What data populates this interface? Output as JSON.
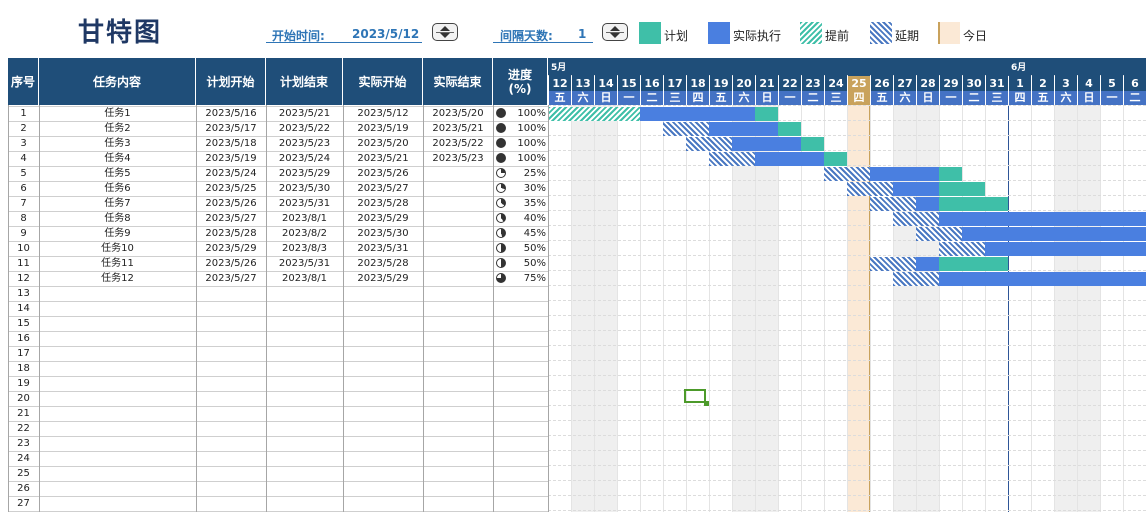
{
  "title": "甘特图",
  "controls": {
    "start_label": "开始时间:",
    "start_value": "2023/5/12",
    "interval_label": "间隔天数:",
    "interval_value": "1"
  },
  "legend": [
    {
      "label": "计划",
      "kind": "plan",
      "color": "#3FBFA8"
    },
    {
      "label": "实际执行",
      "kind": "actual",
      "color": "#4A7FE0"
    },
    {
      "label": "提前",
      "kind": "early",
      "color": "#3FBFA8"
    },
    {
      "label": "延期",
      "kind": "delay",
      "color": "#4A78C2"
    },
    {
      "label": "今日",
      "kind": "today",
      "color": "#FBE9D6"
    }
  ],
  "columns": [
    "序号",
    "任务内容",
    "计划开始",
    "计划结束",
    "实际开始",
    "实际结束",
    "进度\n(%)"
  ],
  "tasks": [
    {
      "no": "1",
      "name": "任务1",
      "plan_start": "2023/5/16",
      "plan_end": "2023/5/21",
      "act_start": "2023/5/12",
      "act_end": "2023/5/20",
      "progress": "100%",
      "pct": 1.0
    },
    {
      "no": "2",
      "name": "任务2",
      "plan_start": "2023/5/17",
      "plan_end": "2023/5/22",
      "act_start": "2023/5/19",
      "act_end": "2023/5/21",
      "progress": "100%",
      "pct": 1.0
    },
    {
      "no": "3",
      "name": "任务3",
      "plan_start": "2023/5/18",
      "plan_end": "2023/5/23",
      "act_start": "2023/5/20",
      "act_end": "2023/5/22",
      "progress": "100%",
      "pct": 1.0
    },
    {
      "no": "4",
      "name": "任务4",
      "plan_start": "2023/5/19",
      "plan_end": "2023/5/24",
      "act_start": "2023/5/21",
      "act_end": "2023/5/23",
      "progress": "100%",
      "pct": 1.0
    },
    {
      "no": "5",
      "name": "任务5",
      "plan_start": "2023/5/24",
      "plan_end": "2023/5/29",
      "act_start": "2023/5/26",
      "act_end": "",
      "progress": "25%",
      "pct": 0.25
    },
    {
      "no": "6",
      "name": "任务6",
      "plan_start": "2023/5/25",
      "plan_end": "2023/5/30",
      "act_start": "2023/5/27",
      "act_end": "",
      "progress": "30%",
      "pct": 0.3
    },
    {
      "no": "7",
      "name": "任务7",
      "plan_start": "2023/5/26",
      "plan_end": "2023/5/31",
      "act_start": "2023/5/28",
      "act_end": "",
      "progress": "35%",
      "pct": 0.35
    },
    {
      "no": "8",
      "name": "任务8",
      "plan_start": "2023/5/27",
      "plan_end": "2023/8/1",
      "act_start": "2023/5/29",
      "act_end": "",
      "progress": "40%",
      "pct": 0.4
    },
    {
      "no": "9",
      "name": "任务9",
      "plan_start": "2023/5/28",
      "plan_end": "2023/8/2",
      "act_start": "2023/5/30",
      "act_end": "",
      "progress": "45%",
      "pct": 0.45
    },
    {
      "no": "10",
      "name": "任务10",
      "plan_start": "2023/5/29",
      "plan_end": "2023/8/3",
      "act_start": "2023/5/31",
      "act_end": "",
      "progress": "50%",
      "pct": 0.5
    },
    {
      "no": "11",
      "name": "任务11",
      "plan_start": "2023/5/26",
      "plan_end": "2023/5/31",
      "act_start": "2023/5/28",
      "act_end": "",
      "progress": "50%",
      "pct": 0.5
    },
    {
      "no": "12",
      "name": "任务12",
      "plan_start": "2023/5/27",
      "plan_end": "2023/8/1",
      "act_start": "2023/5/29",
      "act_end": "",
      "progress": "75%",
      "pct": 0.75
    }
  ],
  "empty_rows": [
    "13",
    "14",
    "15",
    "16",
    "17",
    "18",
    "19",
    "20",
    "21",
    "22",
    "23",
    "24",
    "25",
    "26",
    "27"
  ],
  "calendar": {
    "months": [
      {
        "label": "5月",
        "start_index": 0
      },
      {
        "label": "6月",
        "start_index": 20
      }
    ],
    "days": [
      {
        "d": "12",
        "w": "五"
      },
      {
        "d": "13",
        "w": "六"
      },
      {
        "d": "14",
        "w": "日"
      },
      {
        "d": "15",
        "w": "一"
      },
      {
        "d": "16",
        "w": "二"
      },
      {
        "d": "17",
        "w": "三"
      },
      {
        "d": "18",
        "w": "四"
      },
      {
        "d": "19",
        "w": "五"
      },
      {
        "d": "20",
        "w": "六"
      },
      {
        "d": "21",
        "w": "日"
      },
      {
        "d": "22",
        "w": "一"
      },
      {
        "d": "23",
        "w": "二"
      },
      {
        "d": "24",
        "w": "三"
      },
      {
        "d": "25",
        "w": "四"
      },
      {
        "d": "26",
        "w": "五"
      },
      {
        "d": "27",
        "w": "六"
      },
      {
        "d": "28",
        "w": "日"
      },
      {
        "d": "29",
        "w": "一"
      },
      {
        "d": "30",
        "w": "二"
      },
      {
        "d": "31",
        "w": "三"
      },
      {
        "d": "1",
        "w": "四"
      },
      {
        "d": "2",
        "w": "五"
      },
      {
        "d": "3",
        "w": "六"
      },
      {
        "d": "4",
        "w": "日"
      },
      {
        "d": "5",
        "w": "一"
      },
      {
        "d": "6",
        "w": "二"
      }
    ],
    "today_index": 13,
    "calendar_start": "2023/5/12"
  },
  "colors": {
    "header_bg": "#1F4E79",
    "day_header_bg": "#4472C4",
    "today_header": "#C9A25C",
    "plan": "#3FBFA8",
    "actual": "#4A7FE0",
    "weekend_shade": "#EFEFEF",
    "today_col": "#FBE9D6"
  }
}
